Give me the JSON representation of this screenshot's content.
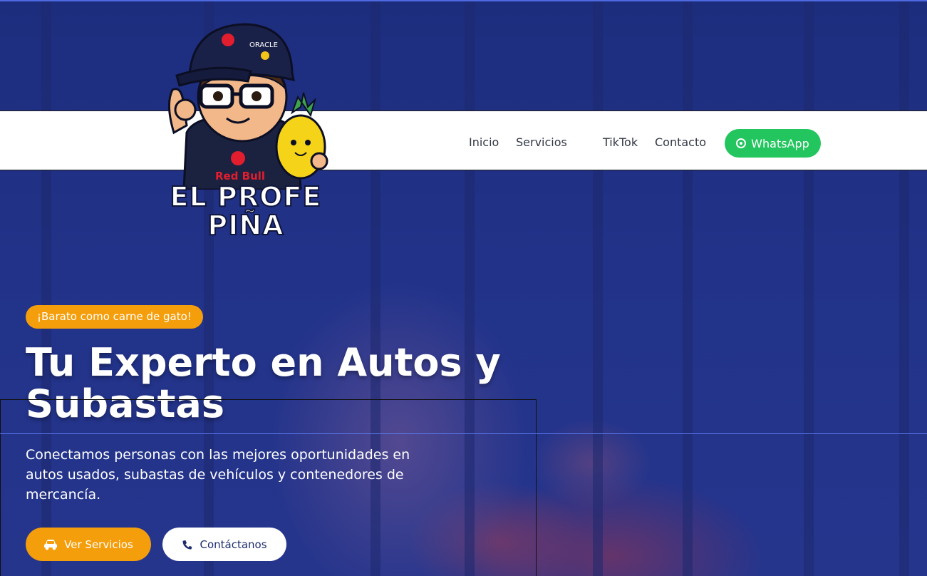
{
  "nav": {
    "links": [
      "Inicio",
      "Servicios",
      "TikTok",
      "Contacto"
    ],
    "whatsapp_label": "WhatsApp"
  },
  "logo": {
    "line1": "EL PROFE",
    "line2": "PIÑA",
    "cap_text": "ORACLE",
    "shirt_text": "Red Bull"
  },
  "hero": {
    "badge": "¡Barato como carne de gato!",
    "title": "Tu Experto en Autos y Subastas",
    "description": "Conectamos personas con las mejores oportunidades en autos usados, subastas de vehículos y contenedores de mercancía.",
    "primary_button": "Ver Servicios",
    "secondary_button": "Contáctanos"
  },
  "colors": {
    "hero_overlay": "#1f3080",
    "accent": "#f59e0b",
    "whatsapp": "#22c55e",
    "nav_text": "#333745"
  },
  "icons": {
    "whatsapp": "whatsapp-icon",
    "car": "car-icon",
    "phone": "phone-icon"
  }
}
